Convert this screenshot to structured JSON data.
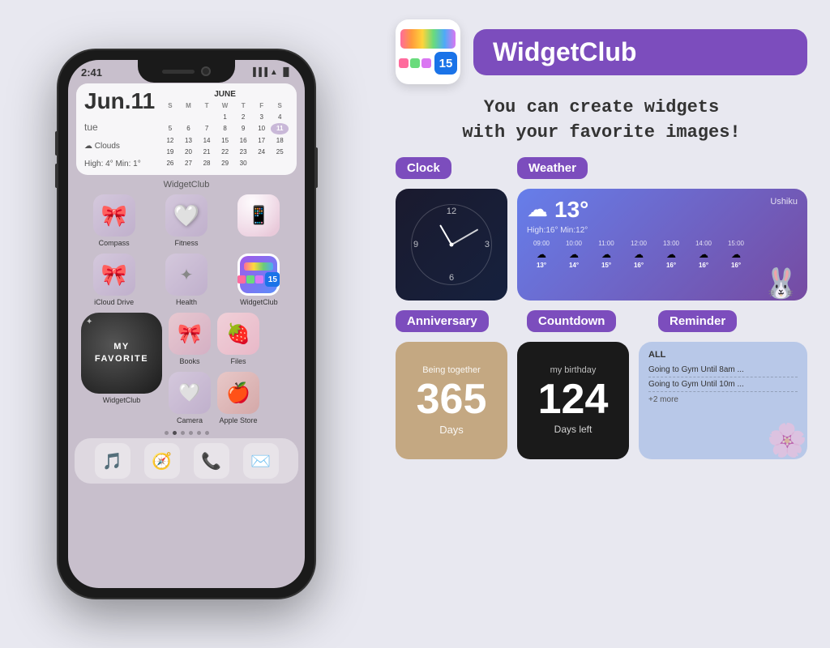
{
  "phone": {
    "status_time": "2:41",
    "screen_bg": "#c8bfcc",
    "calendar_widget": {
      "date": "Jun.11",
      "day": "tue",
      "weather": "☁ Clouds",
      "temp": "High: 4° Min: 1°",
      "month": "JUNE",
      "headers": [
        "S",
        "M",
        "T",
        "W",
        "T",
        "F",
        "S"
      ],
      "days": [
        [
          "",
          "",
          "",
          "1",
          "2",
          "3",
          "4"
        ],
        [
          "5",
          "6",
          "7",
          "8",
          "9",
          "10",
          "11"
        ],
        [
          "12",
          "13",
          "14",
          "15",
          "16",
          "17",
          "18"
        ],
        [
          "19",
          "20",
          "21",
          "22",
          "23",
          "24",
          "25"
        ],
        [
          "26",
          "27",
          "28",
          "29",
          "30",
          "",
          ""
        ]
      ],
      "today": "11"
    },
    "widget_label": "WidgetClub",
    "apps_row1": [
      {
        "name": "Compass",
        "icon": "🎀"
      },
      {
        "name": "Fitness",
        "icon": "🤍"
      },
      {
        "name": "",
        "icon": "📱"
      }
    ],
    "apps_row2": [
      {
        "name": "iCloud Drive",
        "icon": "🎀"
      },
      {
        "name": "Health",
        "icon": "✦"
      },
      {
        "name": "WidgetClub",
        "icon": "📱"
      }
    ],
    "favorite_label": "MY FAVORITE",
    "apps_row3_right": [
      {
        "name": "Books",
        "icon": "🎀"
      },
      {
        "name": "Files",
        "icon": "🍓"
      }
    ],
    "apps_row4_right": [
      {
        "name": "Camera",
        "icon": "🤍"
      },
      {
        "name": "Apple Store",
        "icon": "🍎"
      }
    ],
    "widget_club_label": "WidgetClub",
    "dock": [
      "🎵",
      "🧭",
      "📞",
      "✉️"
    ]
  },
  "right": {
    "app_name": "WidgetClub",
    "tagline_line1": "You can create widgets",
    "tagline_line2": "with your favorite images!",
    "categories": {
      "clock": {
        "label": "Clock",
        "time_display": "12"
      },
      "weather": {
        "label": "Weather",
        "city": "Ushiku",
        "temp": "13°",
        "high_low": "High:16° Min:12°",
        "times": [
          "09:00",
          "10:00",
          "11:00",
          "12:00",
          "13:00",
          "14:00",
          "15:00"
        ],
        "temps": [
          "13°",
          "14°",
          "15°",
          "16°",
          "16°",
          "16°",
          "16°"
        ]
      },
      "anniversary": {
        "label": "Anniversary",
        "subtitle": "Being together",
        "number": "365",
        "unit": "Days"
      },
      "countdown": {
        "label": "Countdown",
        "subtitle": "my birthday",
        "number": "124",
        "unit": "Days left"
      },
      "reminder": {
        "label": "Reminder",
        "all_label": "ALL",
        "items": [
          "Going to Gym Until 8am ...",
          "Going to Gym Until 10m ..."
        ],
        "more": "+2 more"
      }
    }
  }
}
